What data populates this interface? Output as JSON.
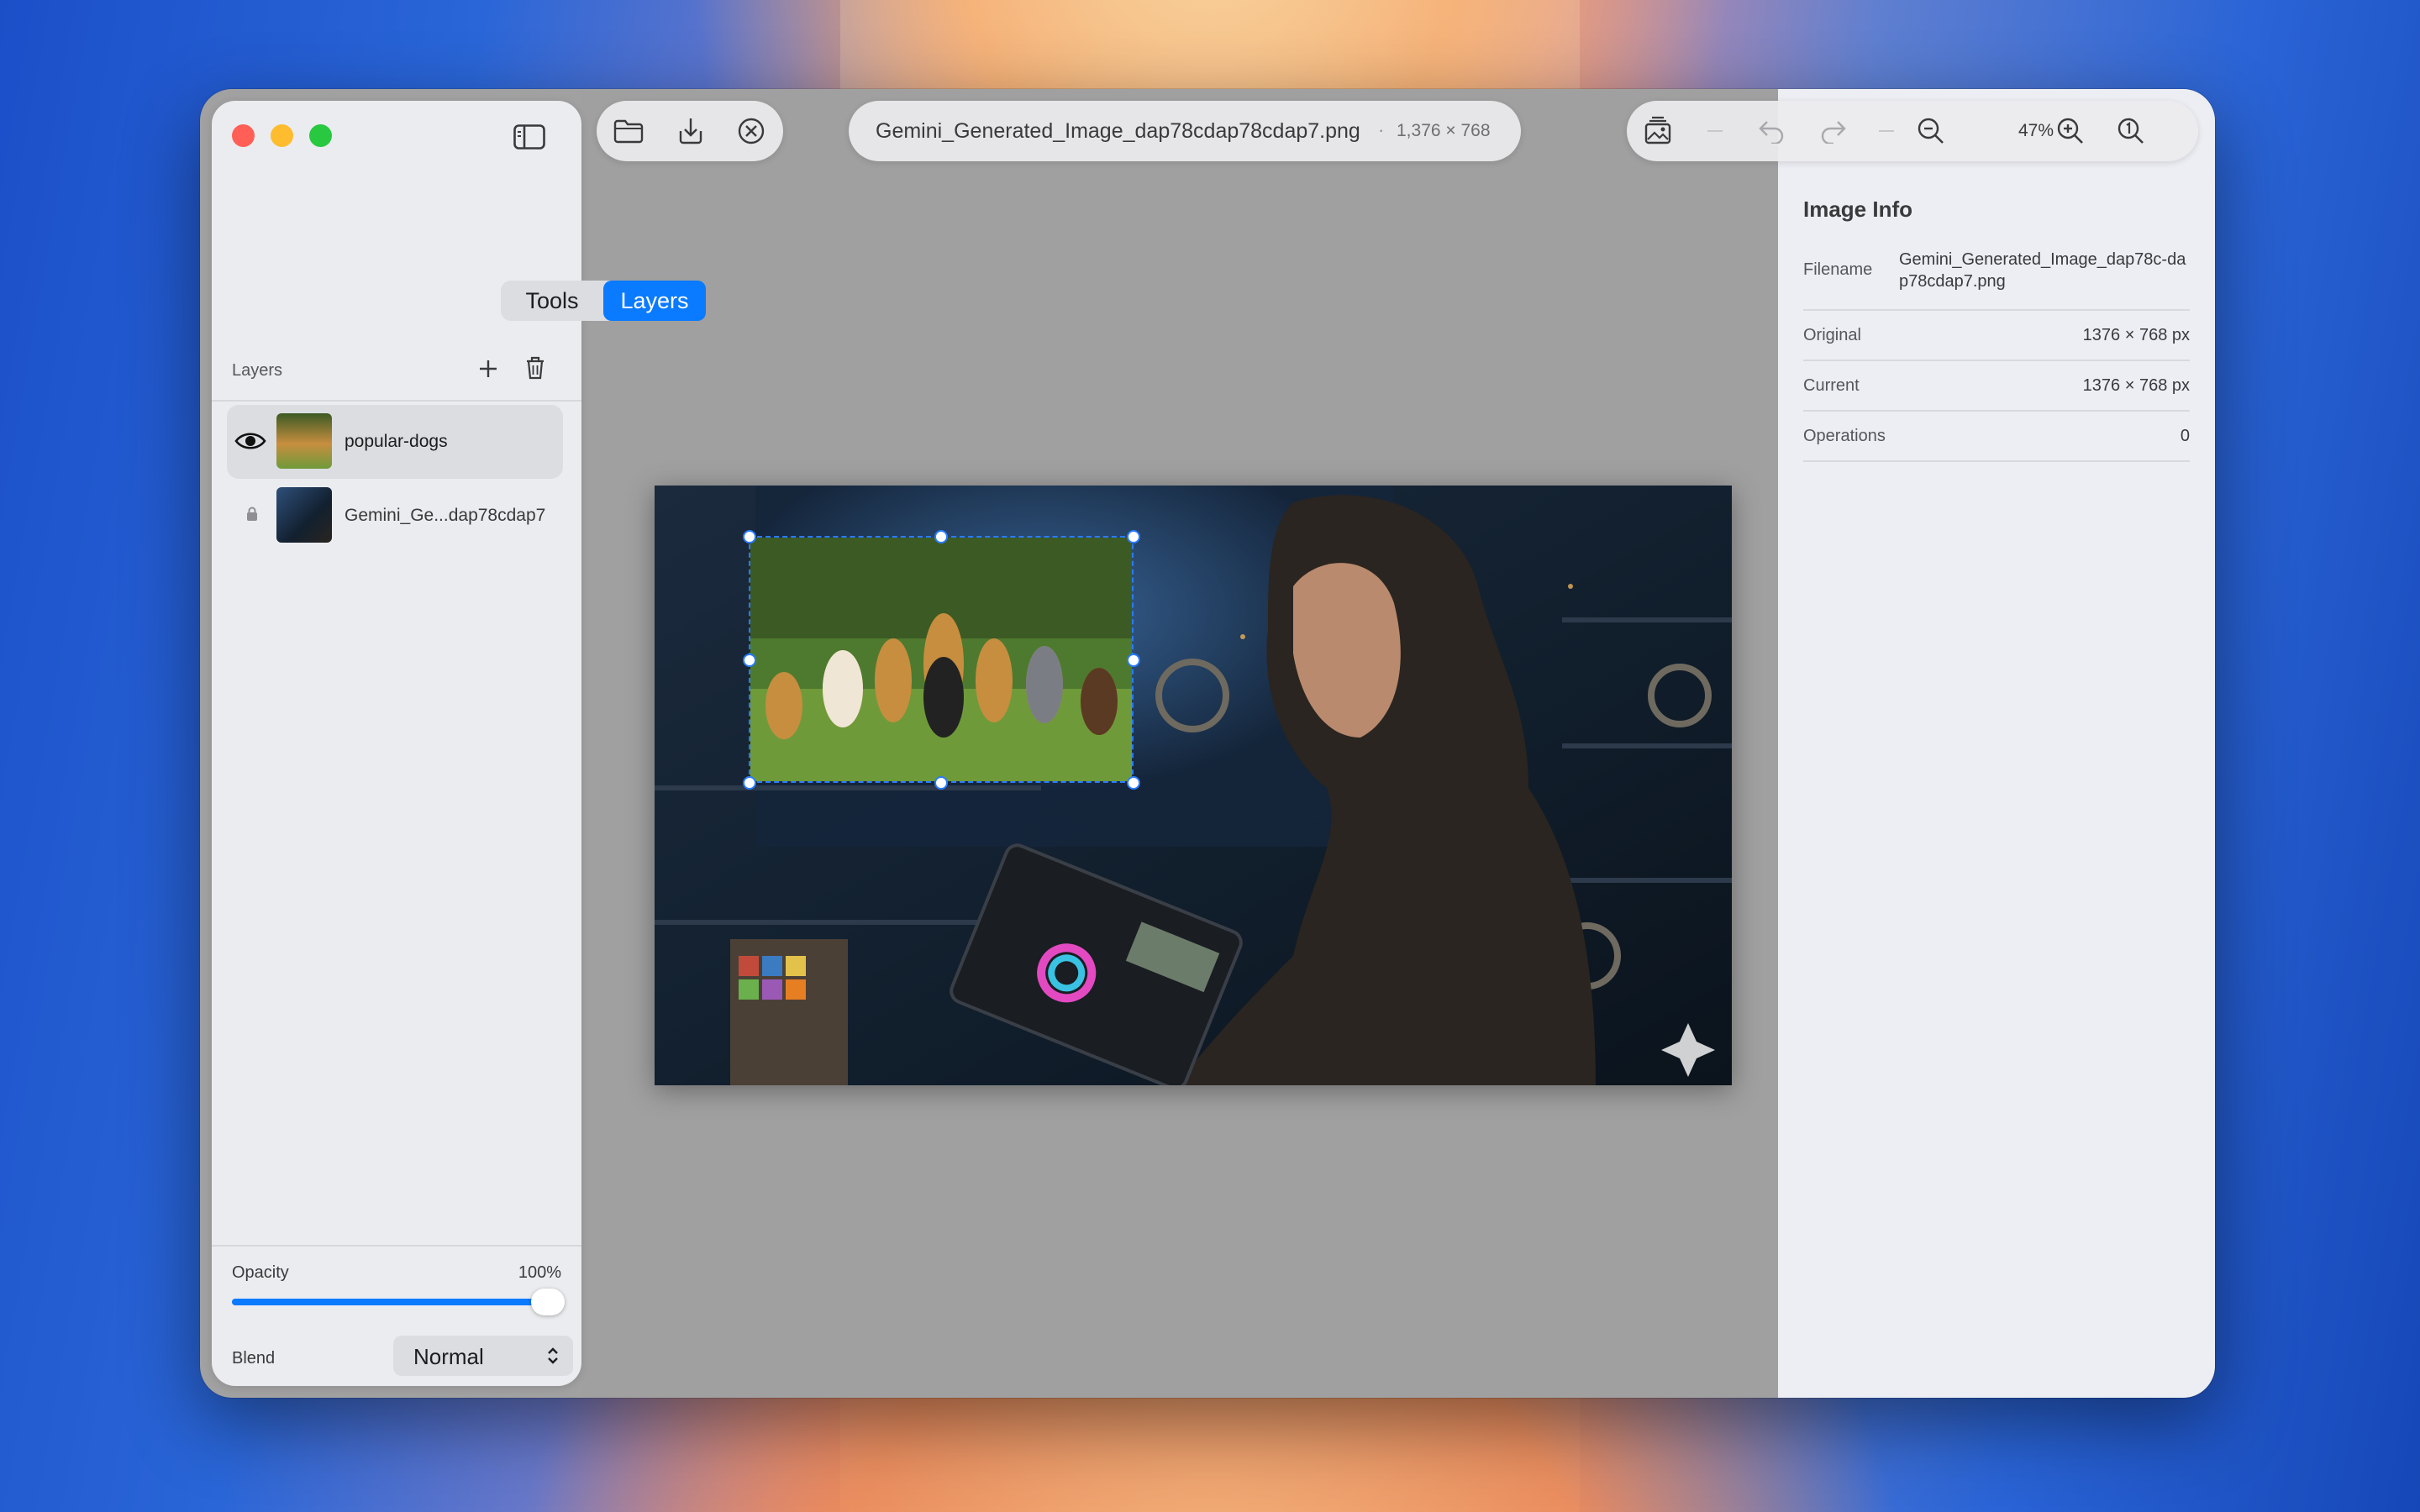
{
  "window": {
    "file_name": "Gemini_Generated_Image_dap78cdap78cdap7.png",
    "file_dims": "1,376 × 768",
    "separator": "·"
  },
  "sidebar": {
    "tabs": [
      {
        "label": "Tools",
        "active": false
      },
      {
        "label": "Layers",
        "active": true
      }
    ],
    "layers_title": "Layers",
    "layers": [
      {
        "name": "popular-dogs",
        "visible": true,
        "selected": true,
        "icon": "eye-icon"
      },
      {
        "name": "Gemini_Ge...dap78cdap7",
        "visible": true,
        "locked": true,
        "icon": "lock-icon"
      }
    ],
    "opacity_label": "Opacity",
    "opacity_value": "100%",
    "opacity_fraction": 1.0,
    "blend_label": "Blend",
    "blend_value": "Normal"
  },
  "toolbar": {
    "zoom": "47%"
  },
  "info": {
    "title": "Image Info",
    "rows": [
      {
        "key": "Filename",
        "value": "Gemini_Generated_Image_dap78c-dap78cdap7.png"
      },
      {
        "key": "Original",
        "value": "1376 × 768 px"
      },
      {
        "key": "Current",
        "value": "1376 × 768 px"
      },
      {
        "key": "Operations",
        "value": "0"
      }
    ]
  },
  "colors": {
    "accent": "#0a7aff",
    "close": "#ff5f57",
    "minimize": "#febc2e",
    "zoom": "#28c840"
  }
}
